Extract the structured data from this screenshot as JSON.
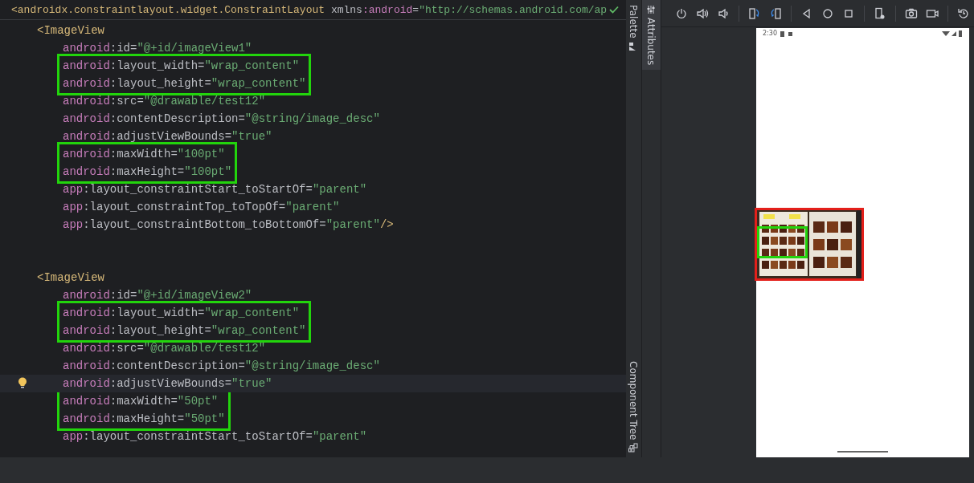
{
  "editor": {
    "sticky_line": [
      {
        "kind": "tag",
        "text": "<androidx.constraintlayout.widget.ConstraintLayout"
      },
      {
        "kind": "plain",
        "text": " xmlns"
      },
      {
        "kind": "ns",
        "text": ":android"
      },
      {
        "kind": "plain",
        "text": "="
      },
      {
        "kind": "value",
        "text": "\"http://schemas.android.com/ap"
      }
    ],
    "lines": [
      {
        "kind": "tag",
        "boxed": false,
        "current": false,
        "bulb": false,
        "segments": [
          {
            "kind": "tag",
            "text": "<ImageView"
          }
        ]
      },
      {
        "kind": "attr",
        "boxed": false,
        "current": false,
        "bulb": false,
        "segments": [
          {
            "kind": "ns",
            "text": "android"
          },
          {
            "kind": "plain",
            "text": ":id="
          },
          {
            "kind": "value",
            "text": "\"@+id/imageView1\""
          }
        ]
      },
      {
        "kind": "attr",
        "boxed": true,
        "current": false,
        "bulb": false,
        "segments": [
          {
            "kind": "ns",
            "text": "android"
          },
          {
            "kind": "plain",
            "text": ":layout_width="
          },
          {
            "kind": "value",
            "text": "\"wrap_content\""
          }
        ]
      },
      {
        "kind": "attr",
        "boxed": true,
        "current": false,
        "bulb": false,
        "segments": [
          {
            "kind": "ns",
            "text": "android"
          },
          {
            "kind": "plain",
            "text": ":layout_height="
          },
          {
            "kind": "value",
            "text": "\"wrap_content\""
          }
        ]
      },
      {
        "kind": "attr",
        "boxed": false,
        "current": false,
        "bulb": false,
        "segments": [
          {
            "kind": "ns",
            "text": "android"
          },
          {
            "kind": "plain",
            "text": ":src="
          },
          {
            "kind": "value",
            "text": "\"@drawable/test12\""
          }
        ]
      },
      {
        "kind": "attr",
        "boxed": false,
        "current": false,
        "bulb": false,
        "segments": [
          {
            "kind": "ns",
            "text": "android"
          },
          {
            "kind": "plain",
            "text": ":contentDescription="
          },
          {
            "kind": "value",
            "text": "\"@string/image_desc\""
          }
        ]
      },
      {
        "kind": "attr",
        "boxed": false,
        "current": false,
        "bulb": false,
        "segments": [
          {
            "kind": "ns",
            "text": "android"
          },
          {
            "kind": "plain",
            "text": ":adjustViewBounds="
          },
          {
            "kind": "value",
            "text": "\"true\""
          }
        ]
      },
      {
        "kind": "attr",
        "boxed": true,
        "current": false,
        "bulb": false,
        "segments": [
          {
            "kind": "ns",
            "text": "android"
          },
          {
            "kind": "plain",
            "text": ":maxWidth="
          },
          {
            "kind": "value",
            "text": "\"100pt\""
          }
        ]
      },
      {
        "kind": "attr",
        "boxed": true,
        "current": false,
        "bulb": false,
        "segments": [
          {
            "kind": "ns",
            "text": "android"
          },
          {
            "kind": "plain",
            "text": ":maxHeight="
          },
          {
            "kind": "value",
            "text": "\"100pt\""
          }
        ]
      },
      {
        "kind": "attr",
        "boxed": false,
        "current": false,
        "bulb": false,
        "segments": [
          {
            "kind": "ns",
            "text": "app"
          },
          {
            "kind": "plain",
            "text": ":layout_constraintStart_toStartOf="
          },
          {
            "kind": "value",
            "text": "\"parent\""
          }
        ]
      },
      {
        "kind": "attr",
        "boxed": false,
        "current": false,
        "bulb": false,
        "segments": [
          {
            "kind": "ns",
            "text": "app"
          },
          {
            "kind": "plain",
            "text": ":layout_constraintTop_toTopOf="
          },
          {
            "kind": "value",
            "text": "\"parent\""
          }
        ]
      },
      {
        "kind": "attr",
        "boxed": false,
        "current": false,
        "bulb": false,
        "segments": [
          {
            "kind": "ns",
            "text": "app"
          },
          {
            "kind": "plain",
            "text": ":layout_constraintBottom_toBottomOf="
          },
          {
            "kind": "value",
            "text": "\"parent\""
          },
          {
            "kind": "tag",
            "text": "/>"
          }
        ]
      },
      {
        "kind": "blank",
        "boxed": false,
        "current": false,
        "bulb": false
      },
      {
        "kind": "blank",
        "boxed": false,
        "current": false,
        "bulb": false
      },
      {
        "kind": "tag",
        "boxed": false,
        "current": false,
        "bulb": false,
        "segments": [
          {
            "kind": "tag",
            "text": "<ImageView"
          }
        ]
      },
      {
        "kind": "attr",
        "boxed": false,
        "current": false,
        "bulb": false,
        "segments": [
          {
            "kind": "ns",
            "text": "android"
          },
          {
            "kind": "plain",
            "text": ":id="
          },
          {
            "kind": "value",
            "text": "\"@+id/imageView2\""
          }
        ]
      },
      {
        "kind": "attr",
        "boxed": true,
        "current": false,
        "bulb": false,
        "segments": [
          {
            "kind": "ns",
            "text": "android"
          },
          {
            "kind": "plain",
            "text": ":layout_width="
          },
          {
            "kind": "value",
            "text": "\"wrap_content\""
          }
        ]
      },
      {
        "kind": "attr",
        "boxed": true,
        "current": false,
        "bulb": false,
        "segments": [
          {
            "kind": "ns",
            "text": "android"
          },
          {
            "kind": "plain",
            "text": ":layout_height="
          },
          {
            "kind": "value",
            "text": "\"wrap_content\""
          }
        ]
      },
      {
        "kind": "attr",
        "boxed": false,
        "current": false,
        "bulb": false,
        "segments": [
          {
            "kind": "ns",
            "text": "android"
          },
          {
            "kind": "plain",
            "text": ":src="
          },
          {
            "kind": "value",
            "text": "\"@drawable/test12\""
          }
        ]
      },
      {
        "kind": "attr",
        "boxed": false,
        "current": false,
        "bulb": false,
        "segments": [
          {
            "kind": "ns",
            "text": "android"
          },
          {
            "kind": "plain",
            "text": ":contentDescription="
          },
          {
            "kind": "value",
            "text": "\"@string/image_desc\""
          }
        ]
      },
      {
        "kind": "attr",
        "boxed": false,
        "current": true,
        "bulb": true,
        "segments": [
          {
            "kind": "ns",
            "text": "android"
          },
          {
            "kind": "plain",
            "text": ":adjustViewBounds="
          },
          {
            "kind": "value",
            "text": "\"true\""
          }
        ]
      },
      {
        "kind": "attr",
        "boxed": true,
        "current": false,
        "bulb": false,
        "segments": [
          {
            "kind": "ns",
            "text": "android"
          },
          {
            "kind": "plain",
            "text": ":maxWidth="
          },
          {
            "kind": "value",
            "text": "\"50pt\""
          }
        ]
      },
      {
        "kind": "attr",
        "boxed": true,
        "current": false,
        "bulb": false,
        "segments": [
          {
            "kind": "ns",
            "text": "android"
          },
          {
            "kind": "plain",
            "text": ":maxHeight="
          },
          {
            "kind": "value",
            "text": "\"50pt\""
          }
        ]
      },
      {
        "kind": "attr",
        "boxed": false,
        "current": false,
        "bulb": false,
        "segments": [
          {
            "kind": "ns",
            "text": "app"
          },
          {
            "kind": "plain",
            "text": ":layout_constraintStart_toStartOf="
          },
          {
            "kind": "value",
            "text": "\"parent\""
          }
        ]
      }
    ]
  },
  "side_tabs": [
    {
      "label": "Palette",
      "selected": false
    },
    {
      "label": "Component Tree",
      "selected": false
    },
    {
      "label": "Attributes",
      "selected": true
    }
  ],
  "preview": {
    "status_time": "2:30",
    "image": {
      "kind": "picture",
      "outlined": true,
      "highlighted": true
    }
  }
}
